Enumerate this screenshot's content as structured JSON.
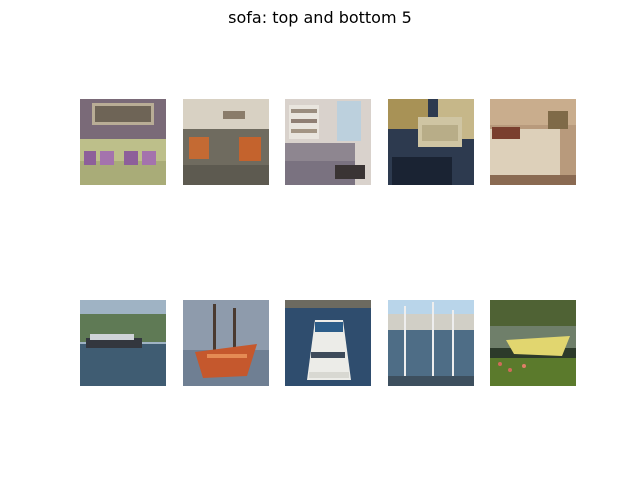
{
  "figure": {
    "title": "sofa: top and bottom 5"
  },
  "top_images": [
    {
      "subject": "sofa-with-purple-cushions"
    },
    {
      "subject": "grey-sofa-with-orange-pillows"
    },
    {
      "subject": "living-room-sofa"
    },
    {
      "subject": "cream-sofa-in-dark-room"
    },
    {
      "subject": "bedroom-with-bed"
    }
  ],
  "bottom_images": [
    {
      "subject": "cruise-ship-on-water"
    },
    {
      "subject": "orange-sailing-ship"
    },
    {
      "subject": "ferry-boat"
    },
    {
      "subject": "marina-with-masts"
    },
    {
      "subject": "yellow-boat-on-shore"
    }
  ]
}
